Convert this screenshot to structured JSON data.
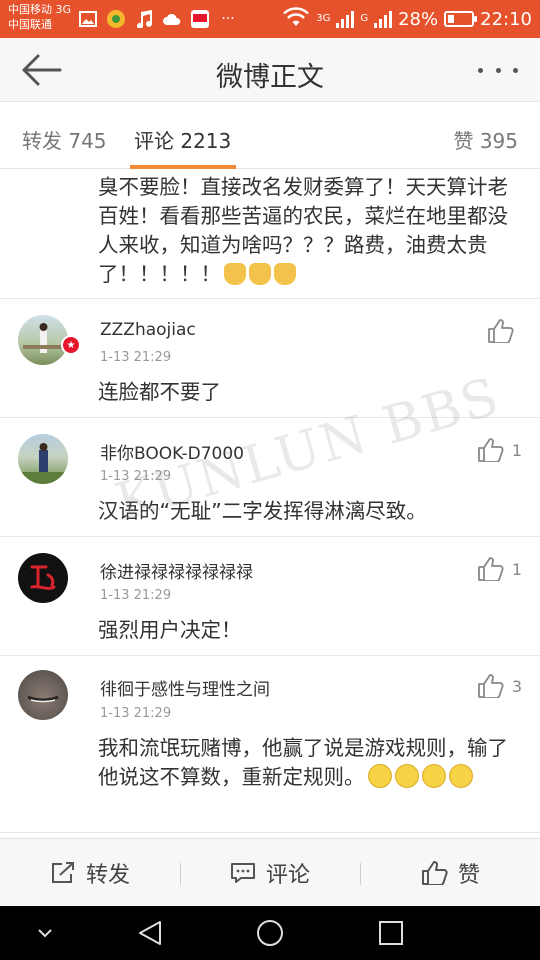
{
  "status_bar": {
    "carrier_1": "中国移动 3G",
    "carrier_2": "中国联通",
    "net_1": "3G",
    "net_2": "G",
    "battery": "28%",
    "battery_level": 0.28,
    "time": "22:10",
    "more": "···"
  },
  "header": {
    "title": "微博正文",
    "back_icon": "arrow-left-icon",
    "more_icon": "more-dots-icon"
  },
  "tabs": {
    "repost": "转发 745",
    "comment": "评论 2213",
    "like": "赞 395",
    "active": "comment",
    "accent": "#f58a32"
  },
  "comments": [
    {
      "text": "臭不要脸！直接改名发财委算了！天天算计老百姓！看看那些苦逼的农民，菜烂在地里都没人来收，知道为啥吗？？？路费，油费太贵了！！！！！",
      "emoji": "thumbs-down"
    },
    {
      "user": "ZZZhaojiac",
      "time": "1-13 21:29",
      "text": "连脸都不要了",
      "likes": ""
    },
    {
      "user": "非你BOOK-D7000",
      "time": "1-13 21:29",
      "text": "汉语的“无耻”二字发挥得淋漓尽致。",
      "likes": "1"
    },
    {
      "user": "徐进禄禄禄禄禄禄禄",
      "time": "1-13 21:29",
      "text": "强烈用户决定！",
      "likes": "1"
    },
    {
      "user": "徘徊于感性与理性之间",
      "time": "1-13 21:29",
      "text": "我和流氓玩赌博，他赢了说是游戏规则，输了他说这不算数，重新定规则。",
      "likes": "3",
      "emoji": "thinking"
    }
  ],
  "watermark": "KUNLUN BBS",
  "actions": {
    "repost": "转发",
    "comment": "评论",
    "like": "赞"
  },
  "colors": {
    "status_bar": "#e5522b",
    "tab_underline": "#f58a32",
    "verified_badge": "#e6162d"
  }
}
